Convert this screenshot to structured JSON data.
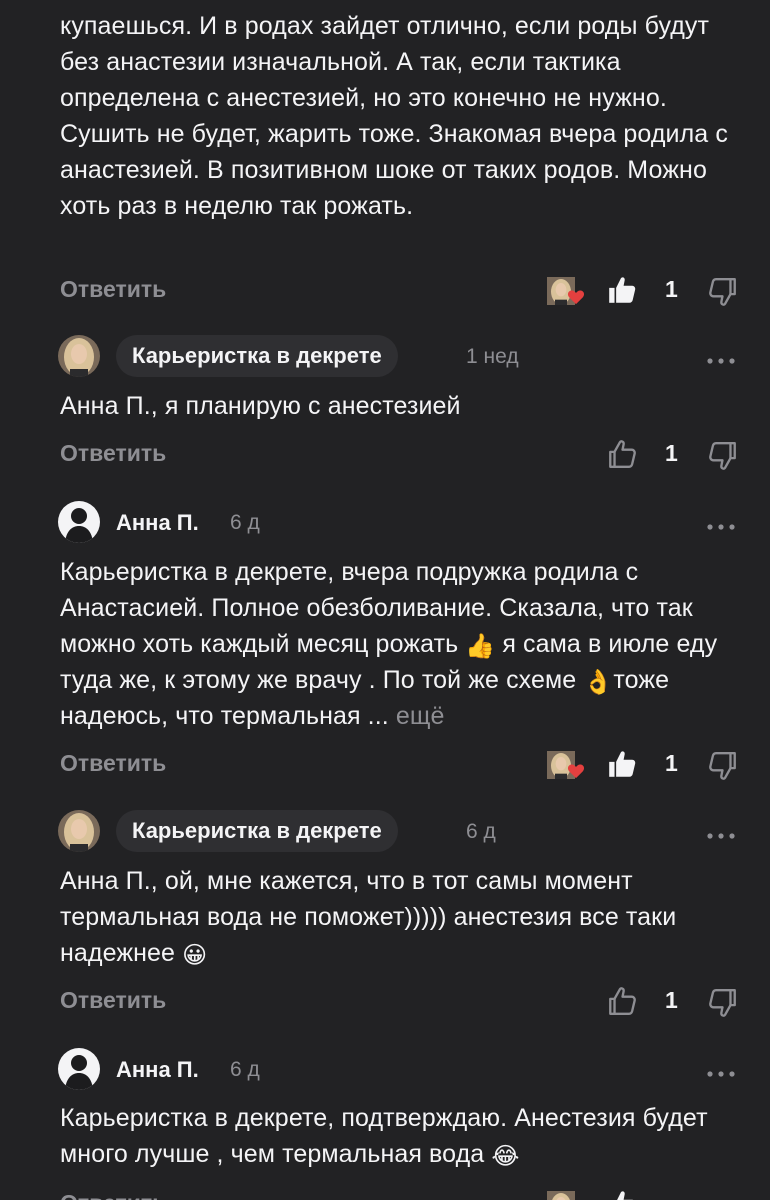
{
  "comments": [
    {
      "text": "купаешься. И в родах зайдет отлично, если роды будут без анастезии изначальной. А так, если тактика определена с анестезией, но это конечно не нужно. Сушить не будет, жарить тоже. Знакомая вчера родила с анастезией. В позитивном шоке от таких родов. Можно хоть раз в неделю так рожать.",
      "reply_label": "Ответить",
      "likes": "1",
      "liked": true
    },
    {
      "author": "Карьеристка в декрете",
      "time": "1 нед",
      "text": "Анна П., я планирую с анестезией",
      "reply_label": "Ответить",
      "likes": "1",
      "liked": false
    },
    {
      "author": "Анна П.",
      "time": "6 д",
      "text_part1": "Карьеристка в декрете, вчера подружка родила с Анастасией. Полное обезболивание. Сказала, что так можно хоть каждый месяц рожать",
      "emoji1": "👍",
      "text_part2": "я сама в июле еду туда же, к этому же врачу . По той же схеме",
      "emoji2": "👌",
      "text_part3": "тоже надеюсь, что термальная ...",
      "more_label": "ещё",
      "reply_label": "Ответить",
      "likes": "1",
      "liked": true
    },
    {
      "author": "Карьеристка в декрете",
      "time": "6 д",
      "text": "Анна П., ой, мне кажется, что в тот самы момент термальная вода не поможет))))) анестезия все таки надежнее",
      "emoji": "😀",
      "reply_label": "Ответить",
      "likes": "1",
      "liked": false
    },
    {
      "author": "Анна П.",
      "time": "6 д",
      "text": "Карьеристка в декрете, подтверждаю. Анестезия будет много лучше , чем термальная вода",
      "emoji": "😂",
      "reply_label": "Ответить"
    }
  ],
  "icons": {
    "like": "thumb-up-icon",
    "dislike": "thumb-down-icon",
    "more": "more-dots-icon",
    "reaction": "author-heart-reaction-icon"
  },
  "colors": {
    "background": "#222224",
    "pill": "#2f2f32",
    "muted": "#8e8e93",
    "heart": "#e4403f"
  }
}
